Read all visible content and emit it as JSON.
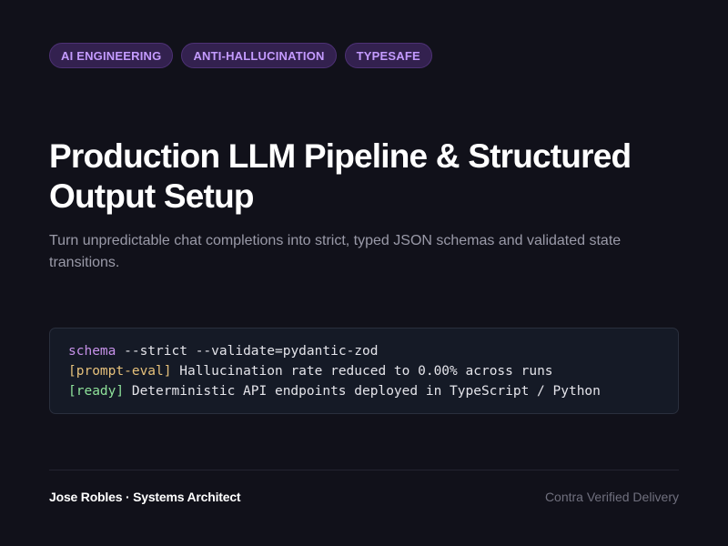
{
  "tags": [
    {
      "label": "AI ENGINEERING"
    },
    {
      "label": "ANTI-HALLUCINATION"
    },
    {
      "label": "TYPESAFE"
    }
  ],
  "header": {
    "title_line1": "Production LLM Pipeline & Structured",
    "title_line2": "Output Setup",
    "subtitle": "Turn unpredictable chat completions into strict, typed JSON schemas and validated state transitions."
  },
  "terminal": {
    "line1_cmd": "schema",
    "line1_rest": " --strict --validate=pydantic-zod",
    "line2_tag": "[prompt-eval]",
    "line2_rest": " Hallucination rate reduced to 0.00% across runs",
    "line3_tag": "[ready]",
    "line3_rest": " Deterministic API endpoints deployed in TypeScript / Python"
  },
  "footer": {
    "author": "Jose Robles · Systems Architect",
    "delivery": "Contra Verified Delivery"
  },
  "colors": {
    "background": "#11111a",
    "tag_bg": "#33214f",
    "tag_text": "#c49bff",
    "command": "#c792ea",
    "eval_tag": "#e5c07b",
    "ready_tag": "#8ee29a"
  }
}
